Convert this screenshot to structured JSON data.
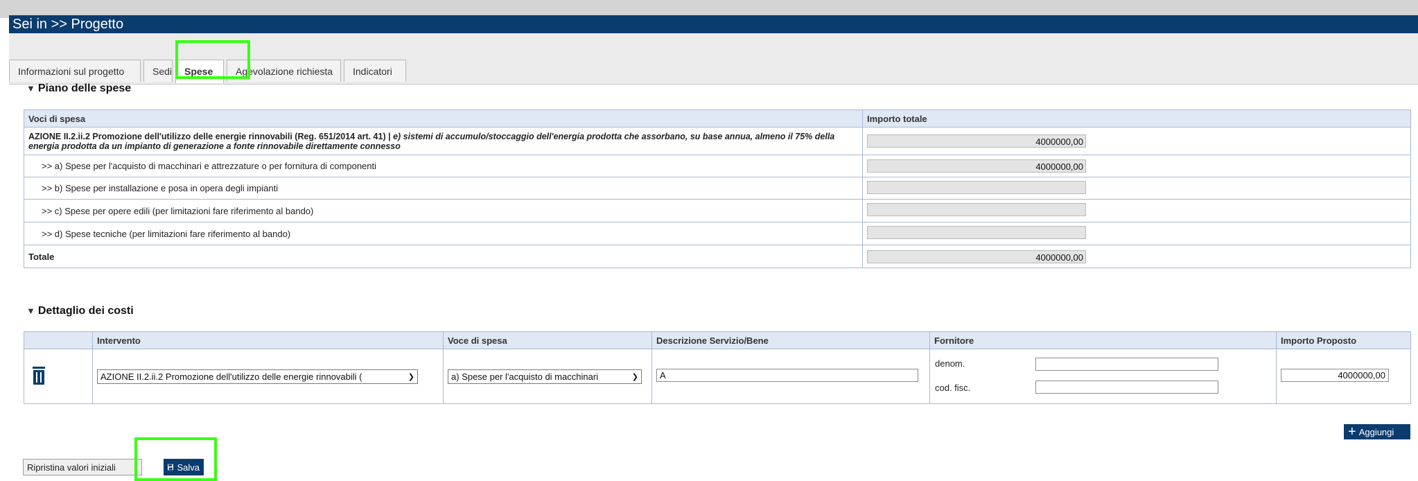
{
  "header": {
    "title": "Sei in >> Progetto"
  },
  "tabs": [
    {
      "label": "Informazioni sul progetto"
    },
    {
      "label": "Sedi"
    },
    {
      "label": "Spese"
    },
    {
      "label": "Agevolazione richiesta"
    },
    {
      "label": "Indicatori"
    }
  ],
  "piano": {
    "title": "Piano delle spese",
    "col_voci": "Voci di spesa",
    "col_importo": "Importo totale",
    "azione_bold": "AZIONE II.2.ii.2 Promozione dell'utilizzo delle energie rinnovabili (Reg. 651/2014 art. 41) | ",
    "azione_italic": "e) sistemi di accumulo/stoccaggio dell'energia prodotta che assorbano, su base annua, almeno il 75% della energia prodotta da un impianto di generazione a fonte rinnovabile direttamente connesso",
    "azione_value": "4000000,00",
    "rows": [
      {
        "label": ">> a) Spese per l'acquisto di macchinari e attrezzature o per fornitura di componenti",
        "value": "4000000,00"
      },
      {
        "label": ">> b) Spese per installazione e posa in opera degli impianti",
        "value": ""
      },
      {
        "label": ">> c) Spese per opere edili (per limitazioni fare riferimento al bando)",
        "value": ""
      },
      {
        "label": ">> d) Spese tecniche (per limitazioni fare riferimento al bando)",
        "value": ""
      }
    ],
    "total_label": "Totale",
    "total_value": "4000000,00"
  },
  "dettaglio": {
    "title": "Dettaglio dei costi",
    "cols": {
      "intervento": "Intervento",
      "voce": "Voce di spesa",
      "descrizione": "Descrizione Servizio/Bene",
      "fornitore": "Fornitore",
      "importo": "Importo Proposto"
    },
    "row": {
      "intervento": "AZIONE II.2.ii.2 Promozione dell'utilizzo delle energie rinnovabili (",
      "voce": "a) Spese per l'acquisto di macchinari",
      "descrizione": "A",
      "denom_label": "denom.",
      "denom_value": "",
      "codfisc_label": "cod. fisc.",
      "codfisc_value": "",
      "importo": "4000000,00"
    }
  },
  "buttons": {
    "aggiungi": "Aggiungi",
    "ripristina": "Ripristina valori iniziali",
    "salva": "Salva"
  },
  "colors": {
    "header_bg": "#0b3c6e",
    "highlight": "#39ff14",
    "table_header_bg": "#dfe8f4"
  }
}
